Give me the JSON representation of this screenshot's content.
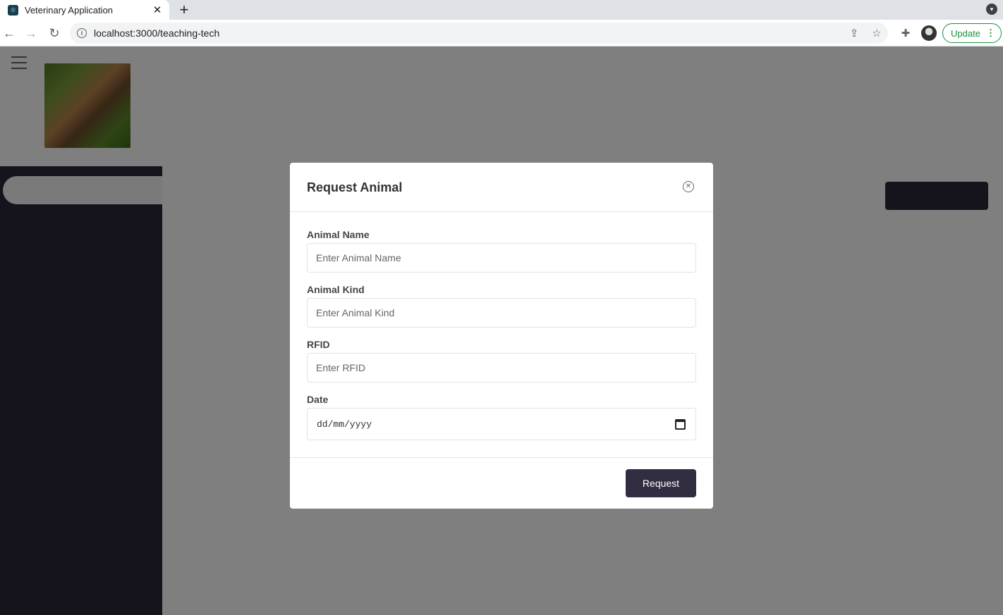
{
  "browser": {
    "tab_title": "Veterinary Application",
    "url": "localhost:3000/teaching-tech",
    "update_label": "Update"
  },
  "modal": {
    "title": "Request Animal",
    "fields": [
      {
        "label": "Animal Name",
        "placeholder": "Enter Animal Name"
      },
      {
        "label": "Animal Kind",
        "placeholder": "Enter Animal Kind"
      },
      {
        "label": "RFID",
        "placeholder": "Enter RFID"
      },
      {
        "label": "Date",
        "placeholder": "dd/mm/yyyy"
      }
    ],
    "submit_label": "Request"
  }
}
